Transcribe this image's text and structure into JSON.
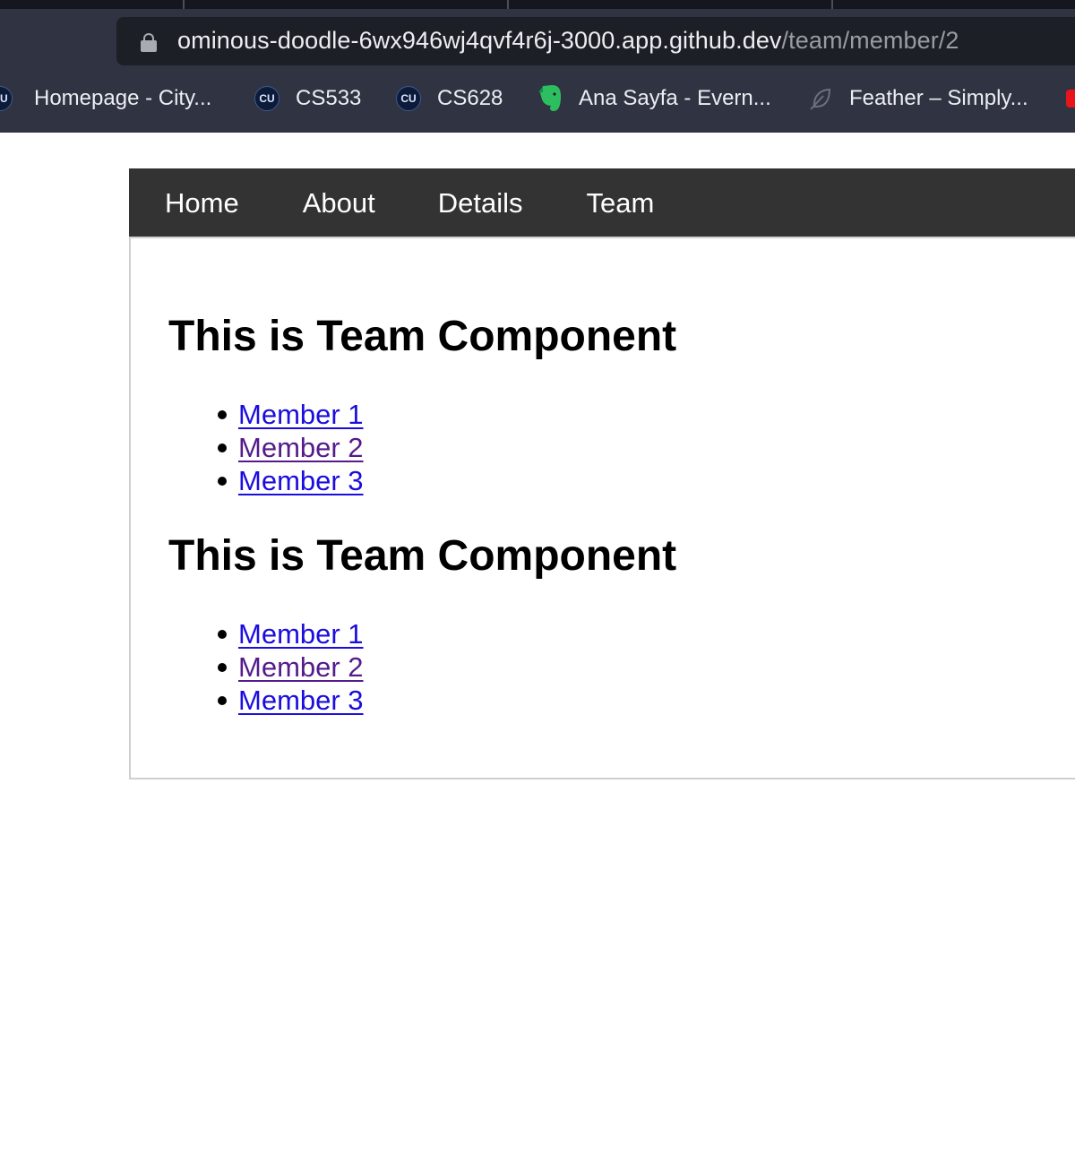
{
  "browser": {
    "url_host": "ominous-doodle-6wx946wj4qvf4r6j-3000.app.github.dev",
    "url_path": "/team/member/2",
    "bookmarks": [
      {
        "label": "Homepage - City...",
        "icon": "cu-icon",
        "icon_text": "CU"
      },
      {
        "label": "CS533",
        "icon": "cu-icon",
        "icon_text": "CU"
      },
      {
        "label": "CS628",
        "icon": "cu-icon",
        "icon_text": "CU"
      },
      {
        "label": "Ana Sayfa - Evern...",
        "icon": "evernote-icon"
      },
      {
        "label": "Feather – Simply...",
        "icon": "feather-icon"
      }
    ]
  },
  "nav": {
    "items": [
      {
        "label": "Home"
      },
      {
        "label": "About"
      },
      {
        "label": "Details"
      },
      {
        "label": "Team"
      }
    ]
  },
  "team_sections": [
    {
      "heading": "This is Team Component",
      "members": [
        {
          "label": "Member 1",
          "visited": false
        },
        {
          "label": "Member 2",
          "visited": true
        },
        {
          "label": "Member 3",
          "visited": false
        }
      ]
    },
    {
      "heading": "This is Team Component",
      "members": [
        {
          "label": "Member 1",
          "visited": false
        },
        {
          "label": "Member 2",
          "visited": true
        },
        {
          "label": "Member 3",
          "visited": false
        }
      ]
    }
  ],
  "colors": {
    "link": "#1a0dde",
    "visited_link": "#551a8b",
    "navbar_bg": "#333333"
  }
}
